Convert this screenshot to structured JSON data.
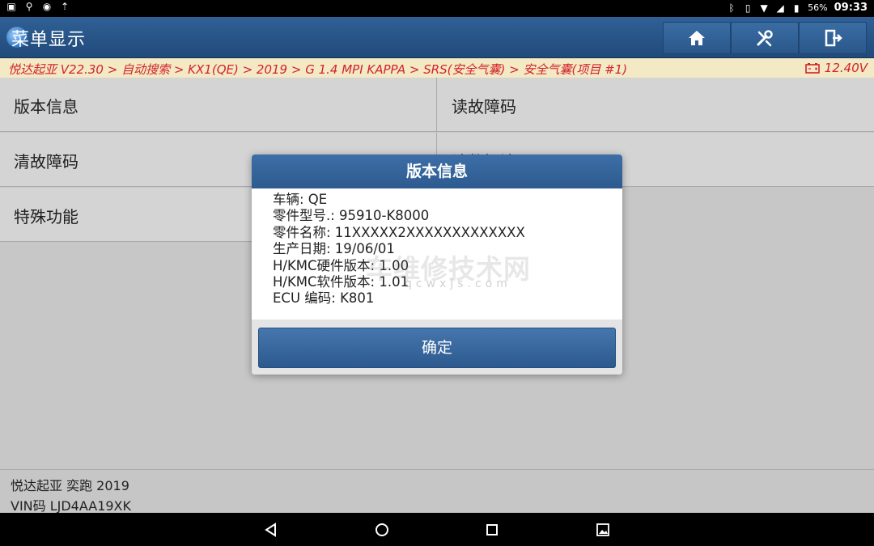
{
  "status_bar": {
    "battery": "56%",
    "time": "09:33"
  },
  "title_bar": {
    "title": "菜单显示",
    "buttons": [
      "home-icon",
      "diagnostic-tools-icon",
      "exit-icon"
    ]
  },
  "breadcrumb": {
    "path": "悦达起亚 V22.30 > 自动搜索 > KX1(QE) > 2019 > G 1.4 MPI KAPPA > SRS(安全气囊) > 安全气囊(项目 #1)",
    "voltage": "12.40V"
  },
  "menu": {
    "items": [
      {
        "label": "版本信息"
      },
      {
        "label": "读故障码"
      },
      {
        "label": "清故障码"
      },
      {
        "label": "读数据流"
      },
      {
        "label": "特殊功能"
      }
    ]
  },
  "dialog": {
    "title": "版本信息",
    "lines": [
      "车辆: QE",
      "零件型号.: 95910-K8000",
      "零件名称: 11XXXXX2XXXXXXXXXXXXX",
      "生产日期: 19/06/01",
      "H/KMC硬件版本: 1.00",
      "H/KMC软件版本: 1.01",
      "ECU 编码: K801"
    ],
    "ok_label": "确定"
  },
  "watermark": {
    "text": "车维修技术网",
    "sub": "qcwxjs.com"
  },
  "footer": {
    "vehicle": "悦达起亚 奕跑 2019",
    "vin": "VIN码 LJD4AA19XK"
  },
  "colors": {
    "header_blue": "#2f6096",
    "breadcrumb_red": "#d2232a",
    "breadcrumb_bg": "#f3e9c4"
  }
}
